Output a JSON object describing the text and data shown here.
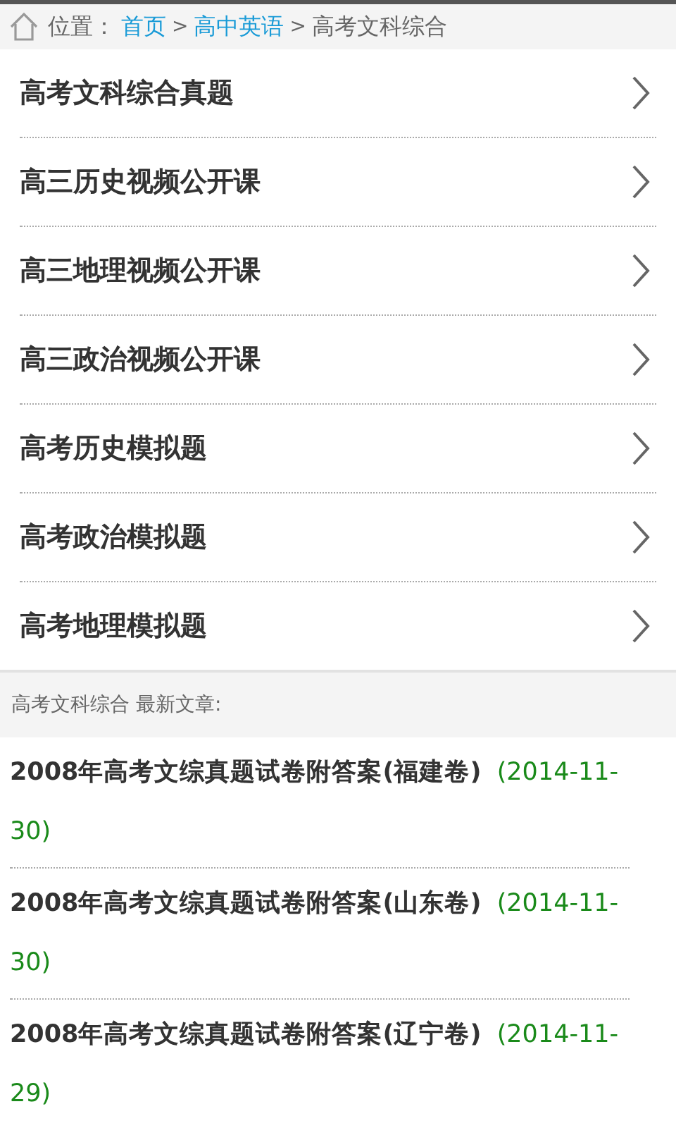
{
  "breadcrumb": {
    "label": "位置：",
    "links": [
      "首页",
      "高中英语"
    ],
    "separators": [
      ">",
      ">"
    ],
    "current": "高考文科综合"
  },
  "categories": [
    {
      "label": "高考文科综合真题"
    },
    {
      "label": "高三历史视频公开课"
    },
    {
      "label": "高三地理视频公开课"
    },
    {
      "label": "高三政治视频公开课"
    },
    {
      "label": "高考历史模拟题"
    },
    {
      "label": "高考政治模拟题"
    },
    {
      "label": "高考地理模拟题"
    }
  ],
  "latest": {
    "heading": "高考文科综合 最新文章:",
    "articles": [
      {
        "title": "2008年高考文综真题试卷附答案(福建卷)",
        "date": "(2014-11-30)"
      },
      {
        "title": "2008年高考文综真题试卷附答案(山东卷)",
        "date": "(2014-11-30)"
      },
      {
        "title": "2008年高考文综真题试卷附答案(辽宁卷)",
        "date": "(2014-11-29)"
      }
    ]
  }
}
